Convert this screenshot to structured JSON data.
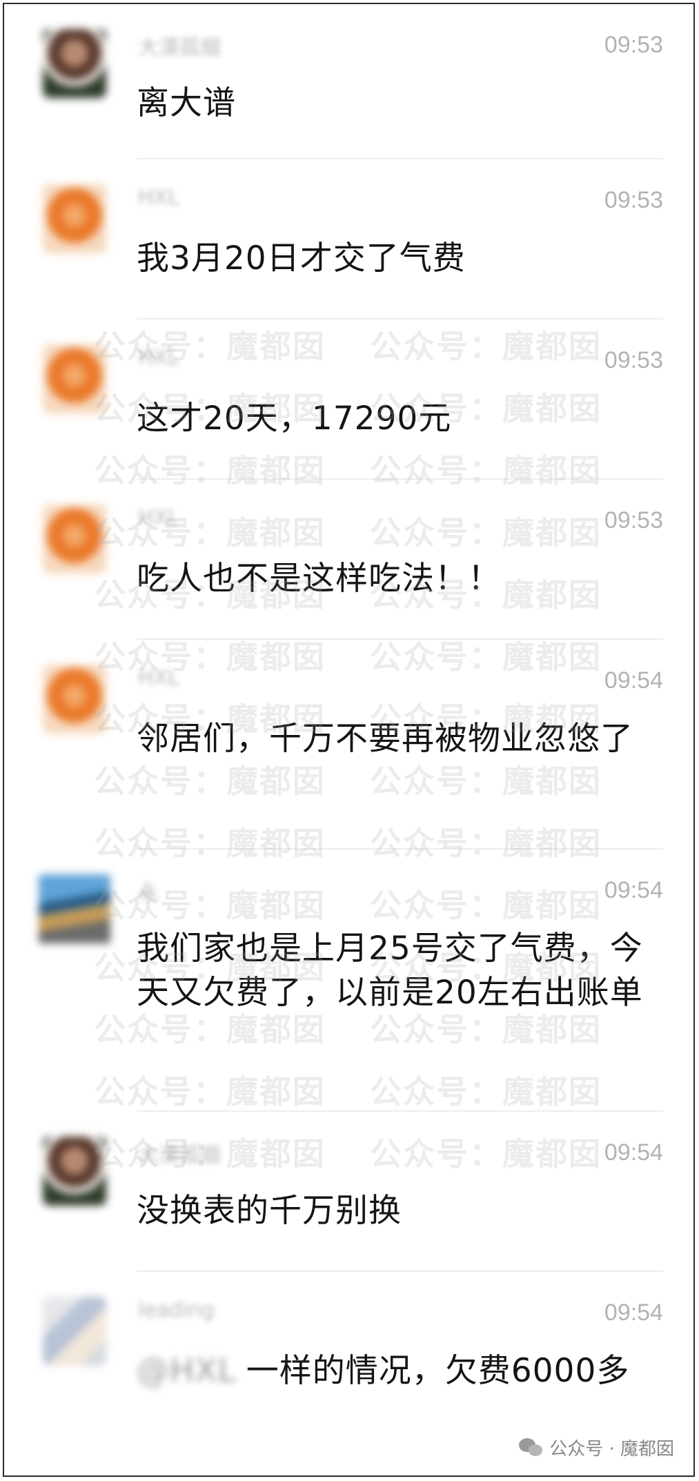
{
  "messages": [
    {
      "name": "大漠孤烟",
      "avatar": "avatar-dark-icon",
      "time": "09:53",
      "text": "离大谱"
    },
    {
      "name": "HXL",
      "avatar": "avatar-orange-icon",
      "time": "09:53",
      "text": "我3月20日才交了气费"
    },
    {
      "name": "HXL",
      "avatar": "avatar-orange-icon",
      "time": "09:53",
      "text": "这才20天，17290元"
    },
    {
      "name": "HXL",
      "avatar": "avatar-orange-icon",
      "time": "09:53",
      "text": "吃人也不是这样吃法！！"
    },
    {
      "name": "HXL",
      "avatar": "avatar-orange-icon",
      "time": "09:54",
      "text": "邻居们，千万不要再被物业忽悠了"
    },
    {
      "name": "永",
      "avatar": "avatar-landscape-icon",
      "time": "09:54",
      "text": "我们家也是上月25号交了气费，今天又欠费了，以前是20左右出账单"
    },
    {
      "name": "大漠孤烟",
      "avatar": "avatar-dark-icon",
      "time": "09:54",
      "text": "没换表的千万别换"
    },
    {
      "name": "leading",
      "avatar": "avatar-light-icon",
      "time": "09:54",
      "mention": "@HXL",
      "text": "一样的情况，欠费6000多"
    }
  ],
  "watermark": "公众号：魔都囡",
  "source_label": "公众号 · 魔都囡",
  "colors": {
    "time": "#b3b3b3",
    "text": "#141414",
    "watermark": "#aaaaaa"
  }
}
